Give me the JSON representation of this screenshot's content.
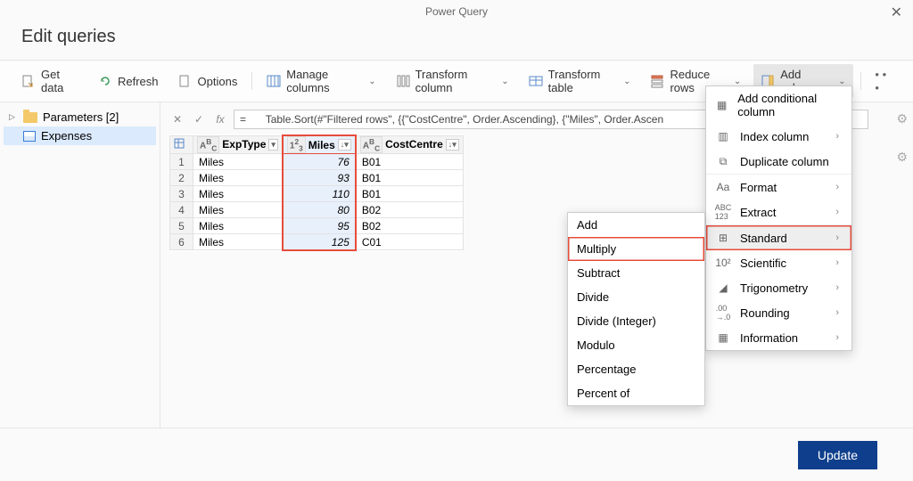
{
  "app": {
    "title": "Power Query",
    "page_title": "Edit queries"
  },
  "toolbar": {
    "get_data": "Get data",
    "refresh": "Refresh",
    "options": "Options",
    "manage_columns": "Manage columns",
    "transform_column": "Transform column",
    "transform_table": "Transform table",
    "reduce_rows": "Reduce rows",
    "add_column": "Add column"
  },
  "sidebar": {
    "parameters": "Parameters  [2]",
    "expenses": "Expenses"
  },
  "formula": {
    "prefix": "=",
    "text": "Table.Sort(#\"Filtered rows\", {{\"CostCentre\", Order.Ascending}, {\"Miles\", Order.Ascen"
  },
  "columns": {
    "exptype": "ExpType",
    "miles": "Miles",
    "costcentre": "CostCentre",
    "type_abc": "A<sup>B</sup>C",
    "type_num": "1<sup>2</sup>3"
  },
  "rows": [
    {
      "n": "1",
      "exptype": "Miles",
      "miles": "76",
      "cc": "B01"
    },
    {
      "n": "2",
      "exptype": "Miles",
      "miles": "93",
      "cc": "B01"
    },
    {
      "n": "3",
      "exptype": "Miles",
      "miles": "110",
      "cc": "B01"
    },
    {
      "n": "4",
      "exptype": "Miles",
      "miles": "80",
      "cc": "B02"
    },
    {
      "n": "5",
      "exptype": "Miles",
      "miles": "95",
      "cc": "B02"
    },
    {
      "n": "6",
      "exptype": "Miles",
      "miles": "125",
      "cc": "C01"
    }
  ],
  "addcol_menu": {
    "conditional": "Add conditional column",
    "index": "Index column",
    "duplicate": "Duplicate column",
    "format": "Format",
    "extract": "Extract",
    "standard": "Standard",
    "scientific": "Scientific",
    "trig": "Trigonometry",
    "rounding": "Rounding",
    "information": "Information"
  },
  "standard_menu": {
    "add": "Add",
    "multiply": "Multiply",
    "subtract": "Subtract",
    "divide": "Divide",
    "divide_int": "Divide (Integer)",
    "modulo": "Modulo",
    "percentage": "Percentage",
    "percent_of": "Percent of"
  },
  "footer": {
    "update": "Update"
  }
}
